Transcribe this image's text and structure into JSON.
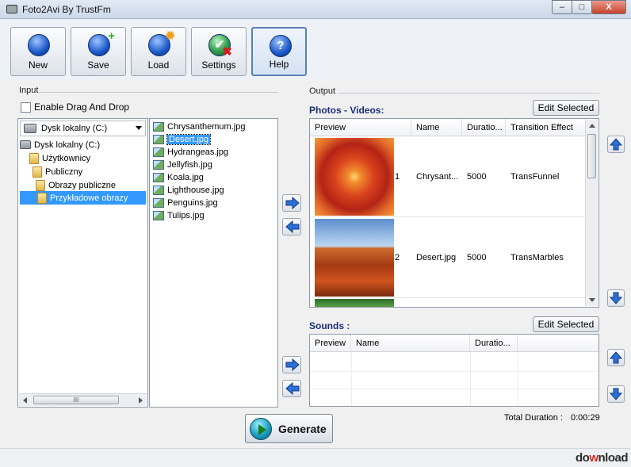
{
  "window": {
    "title": "Foto2Avi By TrustFm",
    "minimize": "–",
    "maximize": "□",
    "close": "X"
  },
  "toolbar": {
    "buttons": [
      {
        "label": "New",
        "icon": "new-icon"
      },
      {
        "label": "Save",
        "icon": "save-icon"
      },
      {
        "label": "Load",
        "icon": "load-icon"
      },
      {
        "label": "Settings",
        "icon": "settings-icon"
      },
      {
        "label": "Help",
        "icon": "help-icon"
      }
    ]
  },
  "input": {
    "section_label": "Input",
    "drag_drop_label": "Enable Drag And Drop",
    "drive_selected": "Dysk lokalny (C:)",
    "tree": [
      {
        "label": "Dysk lokalny (C:)",
        "selected": false
      },
      {
        "label": "Użytkownicy",
        "selected": false
      },
      {
        "label": "Publiczny",
        "selected": false
      },
      {
        "label": "Obrazy publiczne",
        "selected": false
      },
      {
        "label": "Przykładowe obrazy",
        "selected": true
      }
    ],
    "files": [
      "Chrysanthemum.jpg",
      "Desert.jpg",
      "Hydrangeas.jpg",
      "Jellyfish.jpg",
      "Koala.jpg",
      "Lighthouse.jpg",
      "Penguins.jpg",
      "Tulips.jpg"
    ],
    "selected_file": "Desert.jpg",
    "scroll_grip": "III"
  },
  "output": {
    "section_label": "Output",
    "photos": {
      "label": "Photos - Videos:",
      "edit_button": "Edit Selected",
      "columns": [
        "Preview",
        "Name",
        "Duratio...",
        "Transition Effect"
      ],
      "rows": [
        {
          "index": "1",
          "name": "Chrysant...",
          "duration": "5000",
          "transition": "TransFunnel"
        },
        {
          "index": "2",
          "name": "Desert.jpg",
          "duration": "5000",
          "transition": "TransMarbles"
        }
      ]
    },
    "sounds": {
      "label": "Sounds :",
      "edit_button": "Edit Selected",
      "columns": [
        "Preview",
        "Name",
        "Duratio..."
      ]
    }
  },
  "footer": {
    "generate_label": "Generate",
    "total_duration_label": "Total Duration :",
    "total_duration_value": "0:00:29"
  },
  "watermark": {
    "prefix": "do",
    "accent": "w",
    "suffix": "nload"
  },
  "colors": {
    "selection": "#3399ff",
    "accent_label": "#1d2f78",
    "orb_blue": "#1c58c8"
  }
}
